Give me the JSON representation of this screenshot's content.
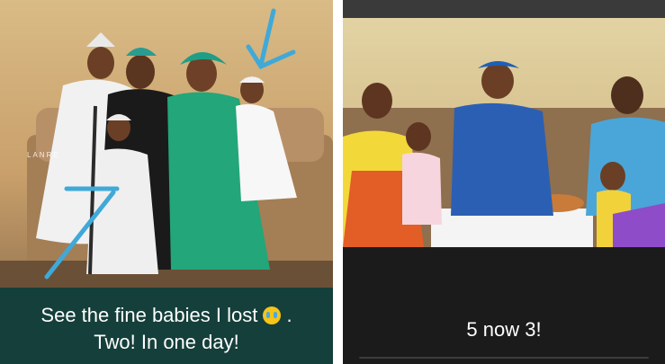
{
  "left_post": {
    "watermark": "LANRE",
    "caption_line1": "See the fine babies I lost",
    "caption_emoji": "loudly-crying-face-emoji",
    "caption_period": ".",
    "caption_line2": "Two! In one day!"
  },
  "right_post": {
    "caption": "5 now 3!"
  },
  "colors": {
    "left_caption_bg": "#153f3b",
    "right_caption_bg": "#1b1b1b",
    "annotation_arrow": "#3fa9d8"
  }
}
